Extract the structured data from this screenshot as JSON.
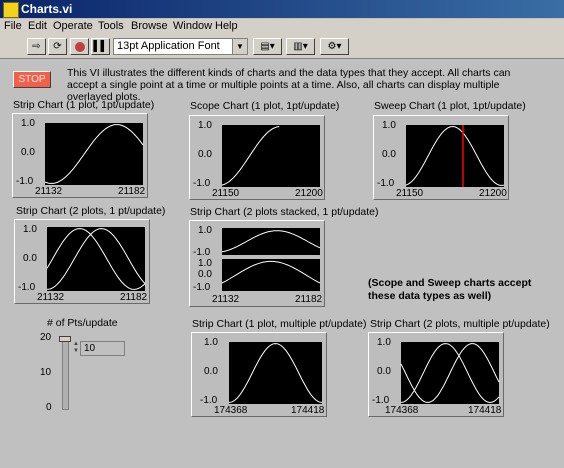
{
  "window": {
    "title": "Charts.vi"
  },
  "menu": [
    "File",
    "Edit",
    "Operate",
    "Tools",
    "Browse",
    "Window",
    "Help"
  ],
  "toolbar": {
    "font": "13pt Application Font",
    "icons": [
      "run-arrow-icon",
      "run-continuous-icon",
      "abort-icon",
      "pause-icon",
      "align-icon",
      "distribute-icon",
      "reorder-icon"
    ]
  },
  "stop": {
    "label": "STOP"
  },
  "description": "This VI illustrates the different kinds of charts and the data types that they accept.  All charts can accept a single point at a time or multiple points at a time.  Also, all charts can display multiple overlayed plots.",
  "note": "(Scope and Sweep charts accept these data types as well)",
  "pts": {
    "label": "# of Pts/update",
    "value": "10",
    "scale": [
      "20",
      "10",
      "0"
    ]
  },
  "charts": [
    {
      "id": "c1",
      "title": "Strip Chart (1 plot, 1pt/update)",
      "y": [
        "1.0",
        "0.0",
        "-1.0"
      ],
      "xmin": "21132",
      "xmax": "21182"
    },
    {
      "id": "c2",
      "title": "Scope Chart (1 plot, 1pt/update)",
      "y": [
        "1.0",
        "0.0",
        "-1.0"
      ],
      "xmin": "21150",
      "xmax": "21200"
    },
    {
      "id": "c3",
      "title": "Sweep Chart (1 plot, 1pt/update)",
      "y": [
        "1.0",
        "0.0",
        "-1.0"
      ],
      "xmin": "21150",
      "xmax": "21200"
    },
    {
      "id": "c4",
      "title": "Strip Chart (2 plots, 1 pt/update)",
      "y": [
        "1.0",
        "0.0",
        "-1.0"
      ],
      "xmin": "21132",
      "xmax": "21182"
    },
    {
      "id": "c5",
      "title": "Strip Chart (2 plots stacked, 1 pt/update)",
      "y": [
        "1.0",
        "-1.0",
        "1.0",
        "0.0",
        "-1.0"
      ],
      "xmin": "21132",
      "xmax": "21182"
    },
    {
      "id": "c6",
      "title": "Strip Chart (1 plot, multiple pt/update)",
      "y": [
        "1.0",
        "0.0",
        "-1.0"
      ],
      "xmin": "174368",
      "xmax": "174418"
    },
    {
      "id": "c7",
      "title": "Strip Chart (2 plots, multiple pt/update)",
      "y": [
        "1.0",
        "0.0",
        "-1.0"
      ],
      "xmin": "174368",
      "xmax": "174418"
    }
  ],
  "colors": {
    "plot_bg": "#000000",
    "trace": "#ffffff",
    "sweep_line": "#ff0000",
    "stop": "#f0604a"
  }
}
